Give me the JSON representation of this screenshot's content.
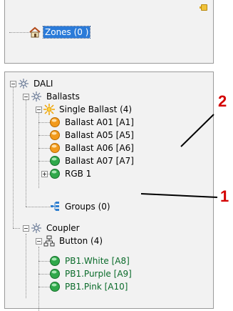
{
  "zones_panel": {
    "root_label": "Zones (0 )"
  },
  "dali_tree": {
    "root": "DALI",
    "ballasts": "Ballasts",
    "single_ballast": "Single Ballast (4)",
    "ballast_items": [
      "Ballast A01 [A1]",
      "Ballast A05 [A5]",
      "Ballast A06 [A6]",
      "Ballast A07 [A7]"
    ],
    "rgb": "RGB 1",
    "groups": "Groups (0)",
    "coupler": "Coupler",
    "button": "Button (4)",
    "button_items": [
      "PB1.White [A8]",
      "PB1.Purple [A9]",
      "PB1.Pink [A10]"
    ]
  },
  "callouts": {
    "label_1": "1",
    "label_2": "2"
  },
  "colors": {
    "selection": "#2b7bd9",
    "callout": "#d40000",
    "status_orange": "#f29a1c",
    "status_green": "#2fa84a"
  },
  "icons": {
    "zones": "house-icon",
    "dali": "network-icon",
    "ballasts": "network-icon",
    "single_ballast": "sun-icon",
    "ballast_status": [
      "orange-status-icon",
      "orange-status-icon",
      "orange-status-icon",
      "green-status-icon"
    ],
    "rgb": "green-status-icon",
    "groups": "groups-icon",
    "coupler": "network-icon",
    "button": "button-tree-icon",
    "button_status": "green-status-icon"
  }
}
